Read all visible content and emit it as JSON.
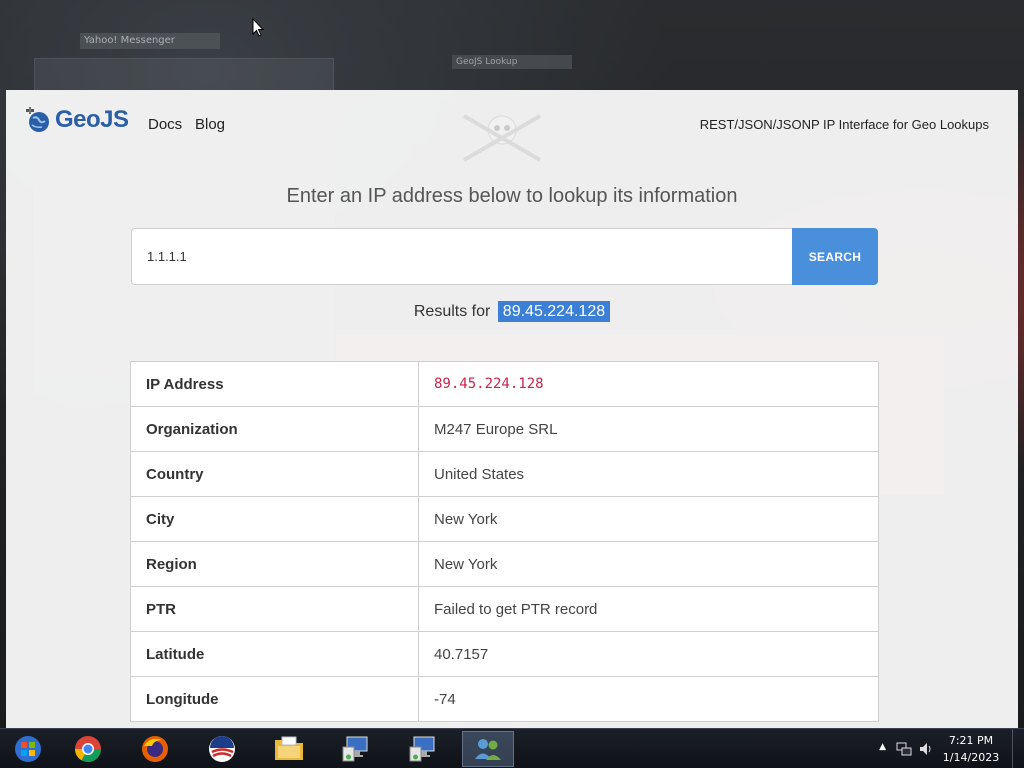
{
  "background": {
    "window_title_1": "Yahoo! Messenger",
    "window_title_2": "GeoJS Lookup"
  },
  "header": {
    "logo_text": "GeoJS",
    "nav": [
      "Docs",
      "Blog"
    ],
    "tagline": "REST/JSON/JSONP IP Interface for Geo Lookups"
  },
  "lookup": {
    "lead": "Enter an IP address below to lookup its information",
    "input_value": "1.1.1.1",
    "search_label": "SEARCH",
    "results_prefix": "Results for",
    "results_ip": "89.45.224.128"
  },
  "results": [
    {
      "key": "IP Address",
      "value": "89.45.224.128"
    },
    {
      "key": "Organization",
      "value": "M247 Europe SRL"
    },
    {
      "key": "Country",
      "value": "United States"
    },
    {
      "key": "City",
      "value": "New York"
    },
    {
      "key": "Region",
      "value": "New York"
    },
    {
      "key": "PTR",
      "value": "Failed to get PTR record"
    },
    {
      "key": "Latitude",
      "value": "40.7157"
    },
    {
      "key": "Longitude",
      "value": "-74"
    }
  ],
  "taskbar": {
    "icons": [
      "start-orb-icon",
      "chrome-icon",
      "firefox-icon",
      "obama-logo-icon",
      "file-explorer-icon",
      "remote-desktop-icon",
      "remote-desktop-icon",
      "users-icon"
    ],
    "time": "7:21 PM",
    "date": "1/14/2023"
  },
  "colors": {
    "brand_blue": "#2a5fa8",
    "search_button": "#4a8fdc",
    "highlight": "#3b7fd6",
    "ip_code": "#c7254e"
  }
}
